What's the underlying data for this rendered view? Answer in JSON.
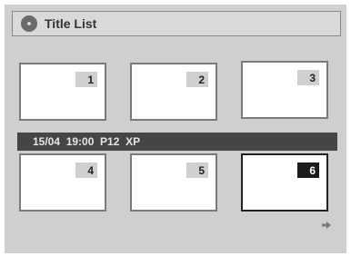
{
  "header": {
    "title": "Title List",
    "icon": "disc-icon"
  },
  "titles": [
    {
      "number": "1",
      "selected": false
    },
    {
      "number": "2",
      "selected": false
    },
    {
      "number": "3",
      "selected": false
    },
    {
      "number": "4",
      "selected": false
    },
    {
      "number": "5",
      "selected": false
    },
    {
      "number": "6",
      "selected": true
    }
  ],
  "info": {
    "text": "15/04  19:00  P12  XP"
  },
  "footer": {
    "icon": "next-page-arrow-icon"
  }
}
